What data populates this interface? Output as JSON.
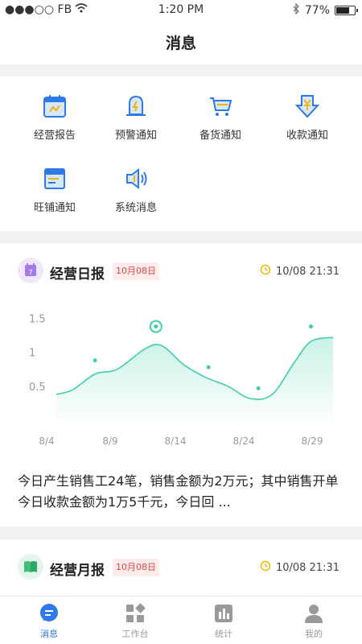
{
  "status_bar": {
    "carrier": "●●●○○ FB",
    "time": "1:20 PM",
    "battery": "77%",
    "battery_level": 0.77
  },
  "header": {
    "title": "消息"
  },
  "menu": {
    "items": [
      {
        "label": "经营报告",
        "icon": "report-calendar-icon"
      },
      {
        "label": "预警通知",
        "icon": "alert-bell-icon"
      },
      {
        "label": "备货通知",
        "icon": "cart-icon"
      },
      {
        "label": "收款通知",
        "icon": "yuan-download-icon"
      },
      {
        "label": "旺铺通知",
        "icon": "store-icon"
      },
      {
        "label": "系统消息",
        "icon": "speaker-icon"
      }
    ]
  },
  "daily": {
    "title": "经营日报",
    "date_tag": "10月08日",
    "time": "10/08 21:31",
    "summary": "今日产生销售工24笔，销售金额为2万元；其中销售开单今日收款金额为1万5千元，今日回 ..."
  },
  "monthly": {
    "title": "经营月报",
    "date_tag": "10月08日",
    "time": "10/08 21:31"
  },
  "chart_data": {
    "type": "area",
    "x_ticks": [
      "8/4",
      "8/9",
      "8/14",
      "8/24",
      "8/29"
    ],
    "y_ticks": [
      "1.5",
      "1",
      "0.5"
    ],
    "ylim": [
      0,
      1.6
    ],
    "curve": [
      {
        "t": 0.0,
        "v": 0.38
      },
      {
        "t": 0.06,
        "v": 0.45
      },
      {
        "t": 0.14,
        "v": 0.68
      },
      {
        "t": 0.22,
        "v": 0.75
      },
      {
        "t": 0.32,
        "v": 1.05
      },
      {
        "t": 0.38,
        "v": 1.1
      },
      {
        "t": 0.46,
        "v": 0.82
      },
      {
        "t": 0.54,
        "v": 0.63
      },
      {
        "t": 0.62,
        "v": 0.5
      },
      {
        "t": 0.7,
        "v": 0.32
      },
      {
        "t": 0.78,
        "v": 0.38
      },
      {
        "t": 0.86,
        "v": 0.85
      },
      {
        "t": 0.92,
        "v": 1.16
      },
      {
        "t": 1.0,
        "v": 1.22
      }
    ],
    "points": [
      {
        "t": 0.14,
        "v": 0.88
      },
      {
        "t": 0.36,
        "v": 1.38,
        "highlight": true
      },
      {
        "t": 0.55,
        "v": 0.78
      },
      {
        "t": 0.73,
        "v": 0.47
      },
      {
        "t": 0.92,
        "v": 1.38
      }
    ],
    "color": "#3fcfa9"
  },
  "tabbar": {
    "tabs": [
      {
        "label": "消息",
        "active": true
      },
      {
        "label": "工作台",
        "active": false
      },
      {
        "label": "统计",
        "active": false
      },
      {
        "label": "我的",
        "active": false
      }
    ]
  },
  "colors": {
    "accent": "#2f79e8",
    "tag_bg": "#fdecec",
    "tag_text": "#e54545",
    "chart": "#3fcfa9"
  }
}
